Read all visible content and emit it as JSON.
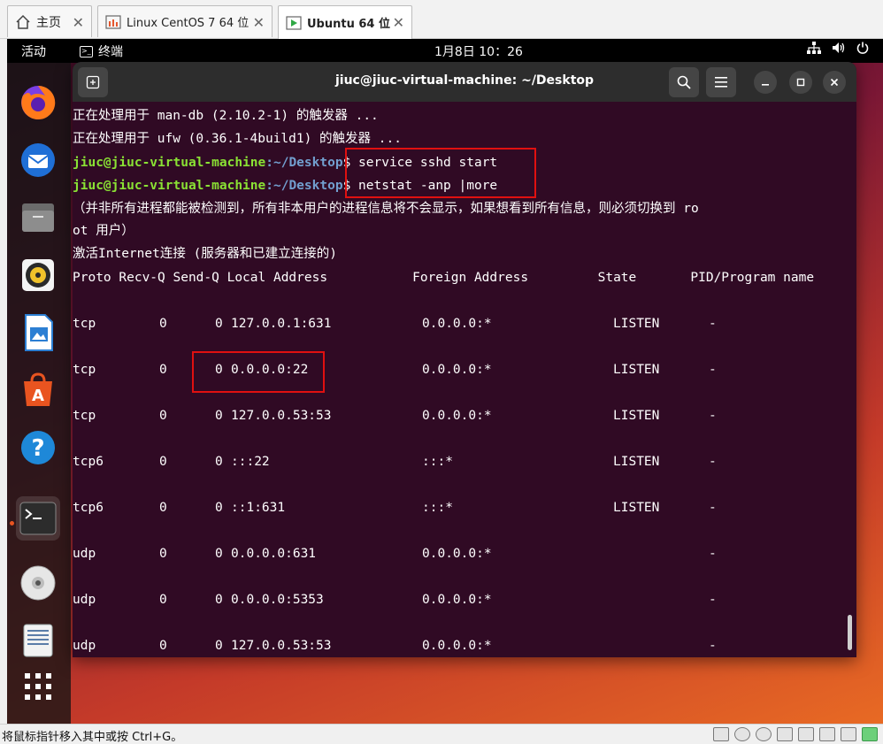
{
  "vm_tabs": [
    {
      "label": "主页",
      "icon": "home-icon"
    },
    {
      "label": "Linux CentOS 7 64 位",
      "icon": "vm-icon"
    },
    {
      "label": "Ubuntu 64 位",
      "icon": "vm-running-icon",
      "active": true
    }
  ],
  "topbar": {
    "activities": "活动",
    "app_name": "终端",
    "clock": "1月8日  10：26"
  },
  "terminal": {
    "title": "jiuc@jiuc-virtual-machine: ~/Desktop",
    "prompt_user": "jiuc@jiuc-virtual-machine",
    "prompt_path": ":~/Desktop",
    "lines": [
      "正在处理用于 man-db (2.10.2-1) 的触发器 ...",
      "正在处理用于 ufw (0.36.1-4build1) 的触发器 ..."
    ],
    "commands": [
      "$ service sshd start",
      "$ netstat -anp |more"
    ],
    "notice_1": "（并非所有进程都能被检测到，所有非本用户的进程信息将不会显示，如果想看到所有信息，则必须切换到 ro",
    "notice_2": "ot 用户）",
    "section_header": "激活Internet连接 (服务器和已建立连接的)",
    "table_header": "Proto Recv-Q Send-Q Local Address           Foreign Address         State       PID/Program name",
    "rows": [
      {
        "proto": "tcp",
        "recvq": "0",
        "sendq": "0",
        "local": "127.0.0.1:631",
        "foreign": "0.0.0.0:*",
        "state": "LISTEN",
        "pid": "-"
      },
      {
        "proto": "tcp",
        "recvq": "0",
        "sendq": "0",
        "local": "0.0.0.0:22",
        "foreign": "0.0.0.0:*",
        "state": "LISTEN",
        "pid": "-"
      },
      {
        "proto": "tcp",
        "recvq": "0",
        "sendq": "0",
        "local": "127.0.0.53:53",
        "foreign": "0.0.0.0:*",
        "state": "LISTEN",
        "pid": "-"
      },
      {
        "proto": "tcp6",
        "recvq": "0",
        "sendq": "0",
        "local": ":::22",
        "foreign": ":::*",
        "state": "LISTEN",
        "pid": "-"
      },
      {
        "proto": "tcp6",
        "recvq": "0",
        "sendq": "0",
        "local": "::1:631",
        "foreign": ":::*",
        "state": "LISTEN",
        "pid": "-"
      },
      {
        "proto": "udp",
        "recvq": "0",
        "sendq": "0",
        "local": "0.0.0.0:631",
        "foreign": "0.0.0.0:*",
        "state": "",
        "pid": "-"
      },
      {
        "proto": "udp",
        "recvq": "0",
        "sendq": "0",
        "local": "0.0.0.0:5353",
        "foreign": "0.0.0.0:*",
        "state": "",
        "pid": "-"
      },
      {
        "proto": "udp",
        "recvq": "0",
        "sendq": "0",
        "local": "127.0.0.53:53",
        "foreign": "0.0.0.0:*",
        "state": "",
        "pid": "-"
      }
    ]
  },
  "dock_apps": [
    "firefox-icon",
    "thunderbird-icon",
    "files-icon",
    "rhythmbox-icon",
    "libreoffice-writer-icon",
    "app-center-icon",
    "help-icon",
    "terminal-icon",
    "dvd-icon",
    "trash-icon",
    "show-apps-icon"
  ],
  "statusbar": {
    "hint": "将鼠标指针移入其中或按 Ctrl+G。"
  },
  "colors": {
    "terminal_bg": "#300a24",
    "prompt_user": "#8ae234",
    "prompt_path": "#729fcf",
    "highlight_box": "#e01010",
    "accent": "#e95420"
  }
}
